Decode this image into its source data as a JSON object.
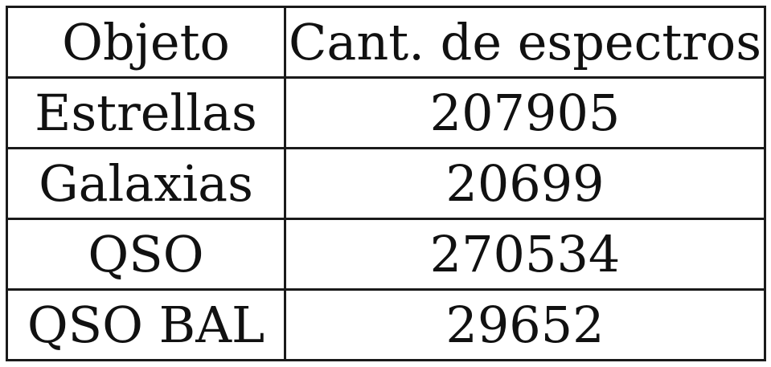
{
  "table": {
    "headers": [
      "Objeto",
      "Cant. de espectros"
    ],
    "rows": [
      [
        "Estrellas",
        "207905"
      ],
      [
        "Galaxias",
        "20699"
      ],
      [
        "QSO",
        "270534"
      ],
      [
        "QSO BAL",
        "29652"
      ]
    ]
  }
}
